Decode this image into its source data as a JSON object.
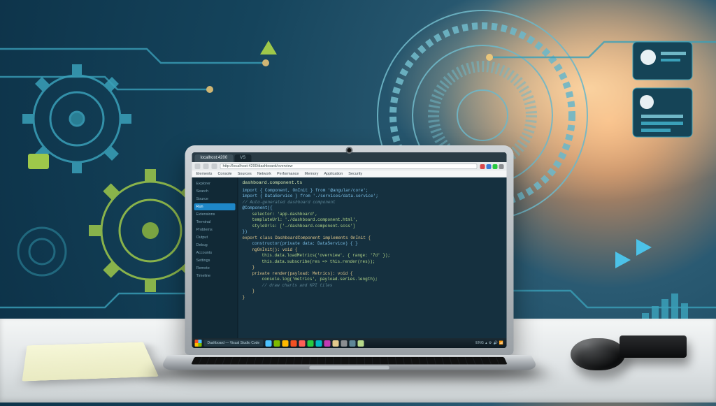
{
  "scene": {
    "description": "Illustration of a laptop on a white desk in front of a tech-themed background of gears, circuits and HUD rings. A notebook, a wireless mouse and a small black device sit on the desk.",
    "objects": [
      "laptop",
      "notebook",
      "mouse",
      "external-drive"
    ]
  },
  "browser": {
    "tabs": [
      {
        "label": "localhost:4200"
      },
      {
        "label": "VS"
      }
    ],
    "active_tab": 0,
    "url": "http://localhost:4200/dashboard/overview",
    "menu": [
      "Elements",
      "Console",
      "Sources",
      "Network",
      "Performance",
      "Memory",
      "Application",
      "Security"
    ]
  },
  "sidebar": {
    "items": [
      "Explorer",
      "Search",
      "Source",
      "Run",
      "Extensions",
      "Terminal",
      "Problems",
      "Output",
      "Debug",
      "Accounts",
      "Settings",
      "Remote",
      "Timeline"
    ],
    "selected_index": 3
  },
  "editor": {
    "filename": "dashboard.component.ts",
    "lines": [
      {
        "cls": "",
        "kind": "kw",
        "text": "import { Component, OnInit } from '@angular/core';"
      },
      {
        "cls": "",
        "kind": "kw",
        "text": "import { DataService } from './services/data.service';"
      },
      {
        "cls": "",
        "kind": "com",
        "text": "// Auto-generated dashboard component"
      },
      {
        "cls": "",
        "kind": "kw",
        "text": "@Component({"
      },
      {
        "cls": "ind1",
        "kind": "str",
        "text": "selector: 'app-dashboard',"
      },
      {
        "cls": "ind1",
        "kind": "str",
        "text": "templateUrl: './dashboard.component.html',"
      },
      {
        "cls": "ind1",
        "kind": "str",
        "text": "styleUrls: ['./dashboard.component.scss']"
      },
      {
        "cls": "",
        "kind": "kw",
        "text": "})"
      },
      {
        "cls": "",
        "kind": "fn",
        "text": "export class DashboardComponent implements OnInit {"
      },
      {
        "cls": "ind1",
        "kind": "kw",
        "text": "constructor(private data: DataService) { }"
      },
      {
        "cls": "ind1",
        "kind": "fn",
        "text": "ngOnInit(): void {"
      },
      {
        "cls": "ind2",
        "kind": "str",
        "text": "this.data.loadMetrics('overview', { range: '7d' });"
      },
      {
        "cls": "ind2",
        "kind": "str",
        "text": "this.data.subscribe(res => this.render(res));"
      },
      {
        "cls": "ind1",
        "kind": "fn",
        "text": "}"
      },
      {
        "cls": "ind1",
        "kind": "fn",
        "text": "private render(payload: Metrics): void {"
      },
      {
        "cls": "ind2",
        "kind": "str",
        "text": "console.log('metrics', payload.series.length);"
      },
      {
        "cls": "ind2",
        "kind": "com",
        "text": "// draw charts and KPI tiles"
      },
      {
        "cls": "ind1",
        "kind": "fn",
        "text": "}"
      },
      {
        "cls": "",
        "kind": "fn",
        "text": "}"
      }
    ]
  },
  "taskbar": {
    "label": "Dashboard — Visual Studio Code",
    "icon_colors": [
      "#4cc2ff",
      "#7fba00",
      "#ffb900",
      "#f25022",
      "#ff5f56",
      "#27c93f",
      "#00b7c3",
      "#c239b3",
      "#e3c98c",
      "#8a8d90",
      "#5e8797",
      "#b6d98a"
    ],
    "tray": "ENG  ▴  ⚙  🔊  📶"
  },
  "colors": {
    "accent": "#1e87c8",
    "editor_bg": "#15303f",
    "sidebar_bg": "#112936"
  }
}
